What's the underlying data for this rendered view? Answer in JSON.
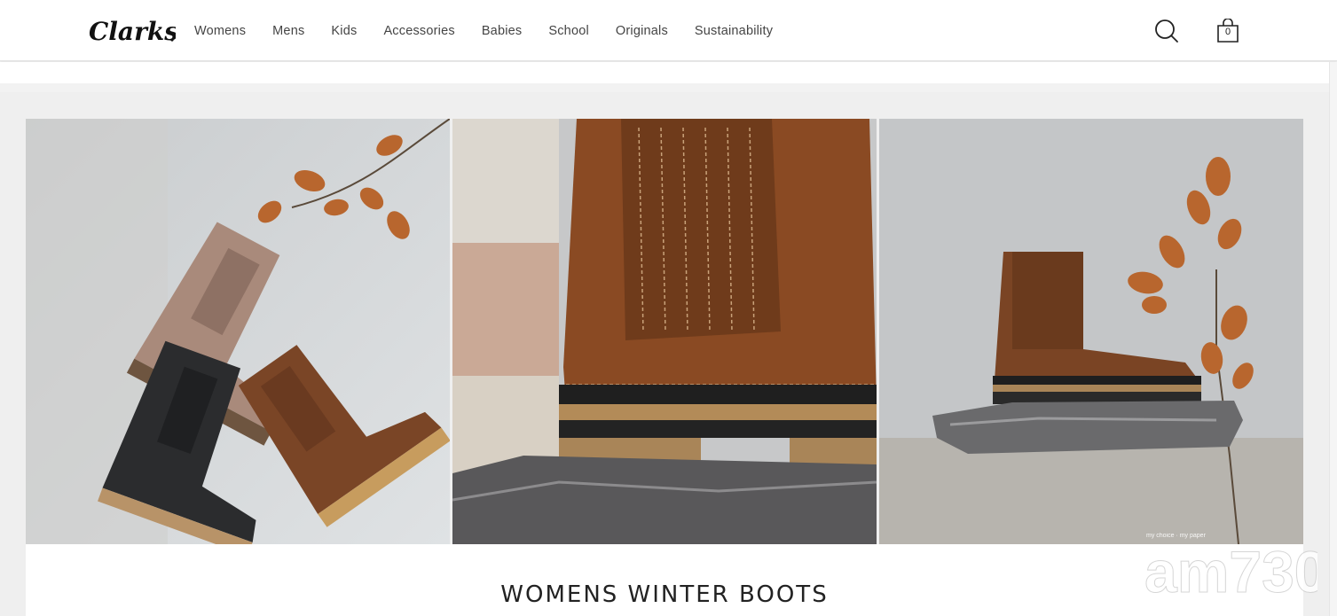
{
  "brand": {
    "logo_text": "Clarks"
  },
  "nav": {
    "items": [
      "Womens",
      "Mens",
      "Kids",
      "Accessories",
      "Babies",
      "School",
      "Originals",
      "Sustainability"
    ]
  },
  "header": {
    "search_icon": "search-icon",
    "bag_icon": "shopping-bag-icon",
    "bag_count": "0"
  },
  "hero": {
    "title": "WOMENS WINTER BOOTS"
  },
  "watermark": {
    "text": "am730",
    "small_text": "my choice · my paper"
  },
  "colors": {
    "header_bg": "#ffffff",
    "page_bg": "#efefef",
    "text": "#222222"
  }
}
